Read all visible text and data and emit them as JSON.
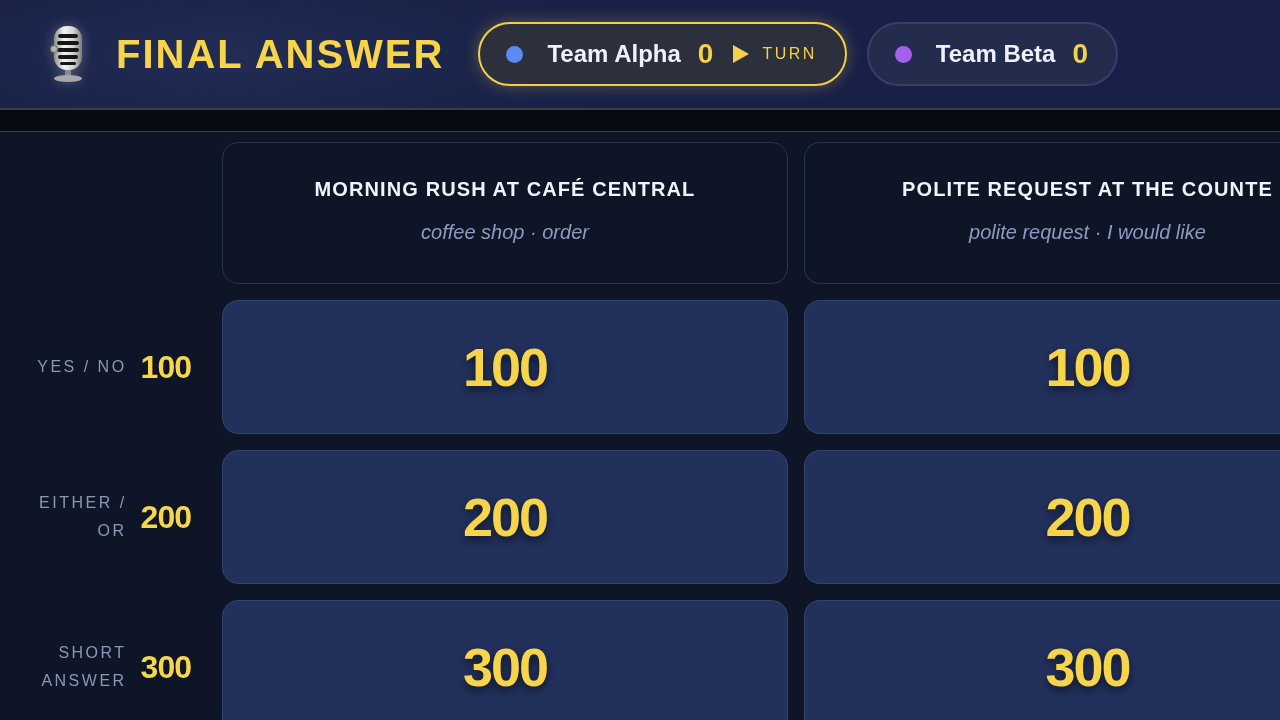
{
  "header": {
    "title": "FINAL ANSWER",
    "teams": [
      {
        "name": "Team Alpha",
        "score": "0",
        "color": "#5b8af0",
        "selected": true,
        "turn_label": "TURN"
      },
      {
        "name": "Team Beta",
        "score": "0",
        "color": "#a262ee",
        "selected": false
      }
    ]
  },
  "board": {
    "categories": [
      {
        "title": "MORNING RUSH AT CAFÉ CENTRAL",
        "subtitle": "coffee shop · order"
      },
      {
        "title": "POLITE REQUEST AT THE COUNTE",
        "subtitle": "polite request · I would like"
      }
    ],
    "rows": [
      {
        "label": "YES / NO",
        "points": "100",
        "cells": [
          "100",
          "100"
        ]
      },
      {
        "label": "EITHER / OR",
        "points": "200",
        "cells": [
          "200",
          "200"
        ]
      },
      {
        "label": "SHORT ANSWER",
        "points": "300",
        "cells": [
          "300",
          "300"
        ]
      }
    ]
  }
}
